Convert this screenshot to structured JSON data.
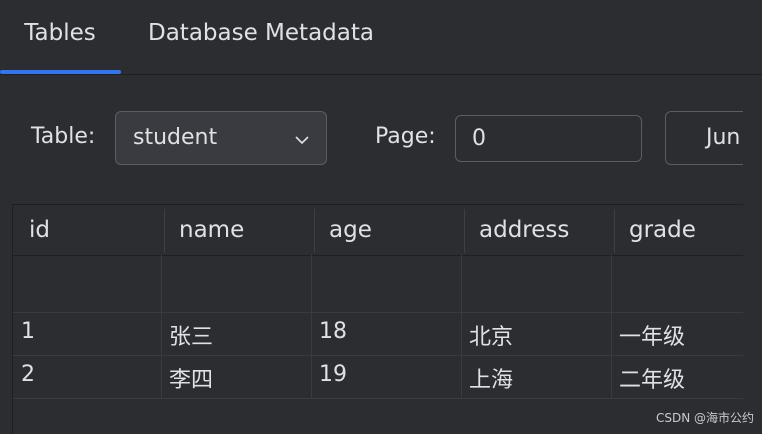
{
  "tabs": [
    {
      "label": "Tables",
      "active": true
    },
    {
      "label": "Database Metadata",
      "active": false
    }
  ],
  "toolbar": {
    "table_label": "Table:",
    "table_selected": "student",
    "page_label": "Page:",
    "page_value": "0",
    "jump_label": "Jun"
  },
  "table": {
    "columns": [
      "id",
      "name",
      "age",
      "address",
      "grade"
    ],
    "rows": [
      [
        "",
        "",
        "",
        "",
        ""
      ],
      [
        "1",
        "张三",
        "18",
        "北京",
        "一年级"
      ],
      [
        "2",
        "李四",
        "19",
        "上海",
        "二年级"
      ]
    ]
  },
  "watermark": "CSDN @海市公约",
  "colors": {
    "background": "#2b2d30",
    "accent": "#3574f0",
    "text": "#dfe1e5",
    "border": "#5a5d63"
  }
}
